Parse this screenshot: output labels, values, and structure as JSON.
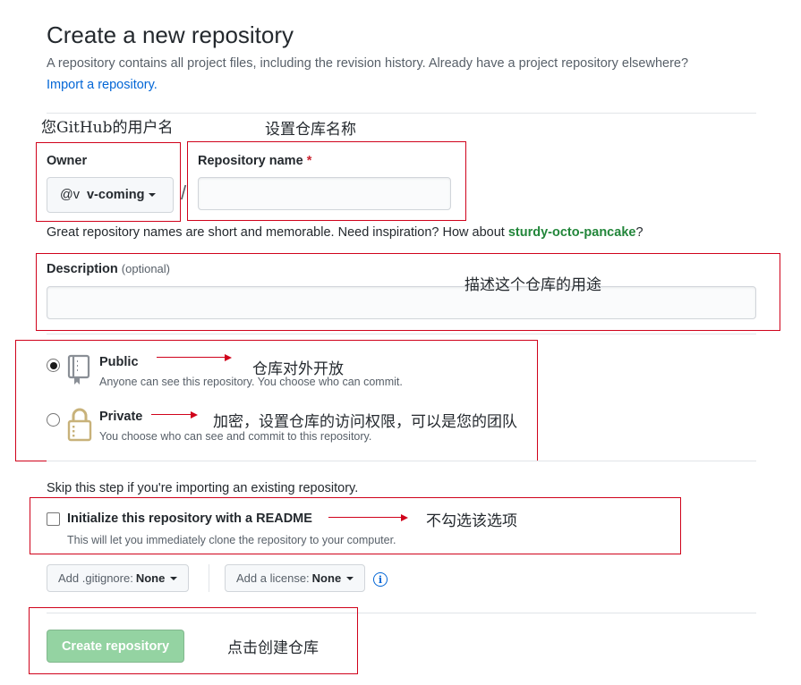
{
  "header": {
    "title": "Create a new repository",
    "description": "A repository contains all project files, including the revision history. Already have a project repository elsewhere?",
    "import_link": "Import a repository."
  },
  "owner": {
    "label": "Owner",
    "avatar_text": "@v",
    "username": "v-coming"
  },
  "repo_name": {
    "label": "Repository name",
    "required_mark": "*",
    "value": "",
    "separator": "/"
  },
  "name_hint": {
    "text": "Great repository names are short and memorable. Need inspiration? How about ",
    "suggestion": "sturdy-octo-pancake",
    "end": "?"
  },
  "description": {
    "label": "Description",
    "optional": "(optional)",
    "value": ""
  },
  "visibility": {
    "public": {
      "title": "Public",
      "description": "Anyone can see this repository. You choose who can commit.",
      "checked": true
    },
    "private": {
      "title": "Private",
      "description": "You choose who can see and commit to this repository.",
      "checked": false
    }
  },
  "init": {
    "skip_text": "Skip this step if you're importing an existing repository.",
    "label": "Initialize this repository with a README",
    "description": "This will let you immediately clone the repository to your computer.",
    "checked": false
  },
  "gitignore": {
    "prefix": "Add .gitignore:",
    "value": "None"
  },
  "license": {
    "prefix": "Add a license:",
    "value": "None"
  },
  "submit": {
    "label": "Create repository",
    "color": "#94d3a2"
  },
  "annotations": {
    "owner": "您GitHub的用户名",
    "repo_name": "设置仓库名称",
    "description": "描述这个仓库的用途",
    "public": "仓库对外开放",
    "private": "加密，设置仓库的访问权限，可以是您的团队",
    "readme": "不勾选该选项",
    "create": "点击创建仓库",
    "color": "#d0021b"
  }
}
